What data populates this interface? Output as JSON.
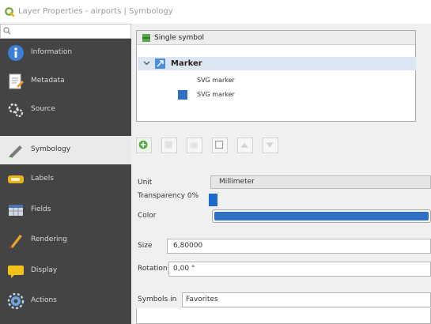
{
  "window": {
    "title": "Layer Properties - airports | Symbology"
  },
  "search": {
    "placeholder": ""
  },
  "sidebar": {
    "items": [
      {
        "label": "Information",
        "icon": "info-icon",
        "selected": false
      },
      {
        "label": "Metadata",
        "icon": "metadata-icon",
        "selected": false
      },
      {
        "label": "Source",
        "icon": "source-icon",
        "selected": false
      },
      {
        "label": "Symbology",
        "icon": "symbology-icon",
        "selected": true
      },
      {
        "label": "Labels",
        "icon": "labels-icon",
        "selected": false
      },
      {
        "label": "Fields",
        "icon": "fields-icon",
        "selected": false
      },
      {
        "label": "Rendering",
        "icon": "rendering-icon",
        "selected": false
      },
      {
        "label": "Display",
        "icon": "display-icon",
        "selected": false
      },
      {
        "label": "Actions",
        "icon": "actions-icon",
        "selected": false
      }
    ]
  },
  "renderer": {
    "label": "Single symbol"
  },
  "symbol_tree": {
    "root": "Marker",
    "layers": [
      "SVG marker",
      "SVG marker"
    ]
  },
  "form": {
    "unit_label": "Unit",
    "unit_value": "Millimeter",
    "transparency_label": "Transparency 0%",
    "transparency_fraction": 0.04,
    "color_label": "Color",
    "color_value": "#2f6fc4",
    "size_label": "Size",
    "size_value": "6,80000",
    "rotation_label": "Rotation",
    "rotation_value": "0,00 °",
    "symbols_in_label": "Symbols in",
    "symbols_in_value": "Favorites"
  },
  "colors": {
    "sidebar_bg": "#444444",
    "accent": "#1e6bcf",
    "marker_blue": "#2f6fc4"
  }
}
